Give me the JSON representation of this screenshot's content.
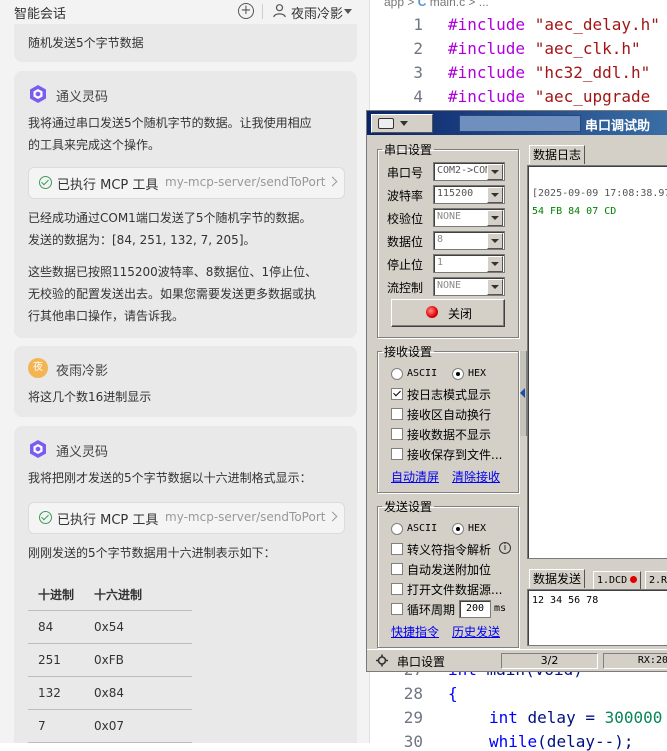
{
  "chat": {
    "title": "智能会话",
    "user_name": "夜雨冷影",
    "messages": [
      {
        "text": "随机发送5个字节数据"
      },
      {
        "sender": "通义灵码",
        "text1": "我将通过串口发送5个随机字节的数据。让我使用相应",
        "text2": "的工具来完成这个操作。",
        "tool_label": "已执行 MCP 工具",
        "tool_server": "my-mcp-server/sendToPort",
        "result1": "已经成功通过COM1端口发送了5个随机字节的数据。",
        "result2": "发送的数据为：[84, 251, 132, 7, 205]。",
        "result3": "这些数据已按照115200波特率、8数据位、1停止位、",
        "result4": "无校验的配置发送出去。如果您需要发送更多数据或执",
        "result5": "行其他串口操作，请告诉我。"
      },
      {
        "sender": "夜雨冷影",
        "avatar": "夜",
        "text": "将这几个数16进制显示"
      },
      {
        "sender": "通义灵码",
        "text1": "我将把刚才发送的5个字节数据以十六进制格式显示：",
        "tool_label": "已执行 MCP 工具",
        "tool_server": "my-mcp-server/sendToPort",
        "text2": "刚刚发送的5个字节数据用十六进制表示如下：",
        "table": {
          "headers": [
            "十进制",
            "十六进制"
          ],
          "rows": [
            [
              "84",
              "0x54"
            ],
            [
              "251",
              "0xFB"
            ],
            [
              "132",
              "0x84"
            ],
            [
              "7",
              "0x07"
            ]
          ]
        }
      }
    ]
  },
  "editor": {
    "breadcrumb_app": "app",
    "breadcrumb_file": "main.c",
    "lines": [
      {
        "n": "1",
        "kw": "#include",
        "s": "\"aec_delay.h\""
      },
      {
        "n": "2",
        "kw": "#include",
        "s": "\"aec_clk.h\""
      },
      {
        "n": "3",
        "kw": "#include",
        "s": "\"hc32_ddl.h\""
      },
      {
        "n": "4",
        "kw": "#include",
        "s": "\"aec_upgrade"
      }
    ],
    "bottom_lines": [
      {
        "n": "27",
        "t1": "int ",
        "t2": "main(void)"
      },
      {
        "n": "28",
        "t1": "{",
        "t2": ""
      },
      {
        "n": "29",
        "t1": "int ",
        "t2": "delay = ",
        "t3": "300000"
      },
      {
        "n": "30",
        "t1": "while",
        "t2": "(delay--);"
      }
    ]
  },
  "serial": {
    "title": "串口调试助",
    "port_group": "串口设置",
    "port_label": "串口号",
    "port_value": "COM2->COM",
    "baud_label": "波特率",
    "baud_value": "115200",
    "parity_label": "校验位",
    "parity_value": "NONE",
    "databits_label": "数据位",
    "databits_value": "8",
    "stopbits_label": "停止位",
    "stopbits_value": "1",
    "flow_label": "流控制",
    "flow_value": "NONE",
    "close_label": "关闭",
    "recv_group": "接收设置",
    "ascii": "ASCII",
    "hex": "HEX",
    "recv_opts": [
      "按日志模式显示",
      "接收区自动换行",
      "接收数据不显示",
      "接收保存到文件..."
    ],
    "recv_opts_checked": [
      true,
      false,
      false,
      false
    ],
    "auto_clear": "自动清屏",
    "clear_recv": "清除接收",
    "send_group": "发送设置",
    "send_opts": [
      "转义符指令解析",
      "自动发送附加位",
      "打开文件数据源...",
      "循环周期"
    ],
    "cycle_value": "200",
    "cycle_unit": "ms",
    "shortcuts": "快捷指令",
    "history": "历史发送",
    "log_tab": "数据日志",
    "log_timestamp": "[2025-09-09 17:08:38.97",
    "log_data": "54 FB 84 07 CD",
    "send_tab": "数据发送",
    "dcd_tab": "1.DCD",
    "tab2": "2.R",
    "send_text": "12 34 56 78",
    "status_left": "串口设置",
    "status_mid": "3/2",
    "status_right": "RX:20",
    "colors": {
      "title_start": "#0a246a",
      "title_end": "#3a6ea5",
      "log_data": "#008000"
    }
  }
}
